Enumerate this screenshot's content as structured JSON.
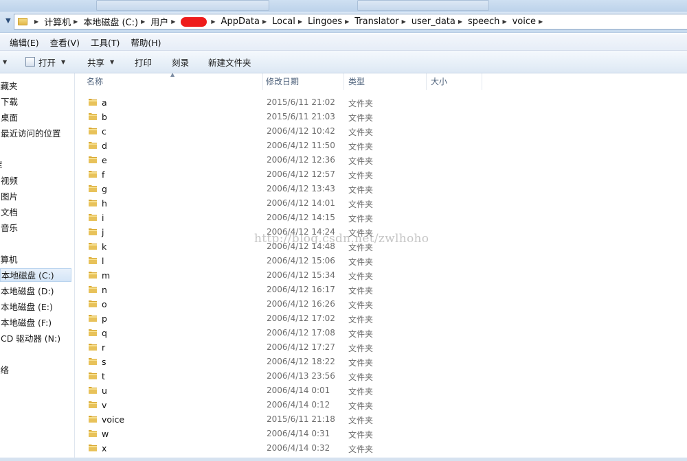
{
  "address": {
    "crumbs": [
      "计算机",
      "本地磁盘 (C:)",
      "用户",
      "",
      "AppData",
      "Local",
      "Lingoes",
      "Translator",
      "user_data",
      "speech",
      "voice"
    ]
  },
  "menu": [
    "编辑(E)",
    "查看(V)",
    "工具(T)",
    "帮助(H)"
  ],
  "toolbar": {
    "open": "打开",
    "share": "共享",
    "print": "打印",
    "burn": "刻录",
    "new_folder": "新建文件夹"
  },
  "nav": {
    "favorites": "收藏夹",
    "downloads": "下载",
    "desktop": "桌面",
    "recent": "最近访问的位置",
    "libraries": "库",
    "videos": "视频",
    "pictures": "图片",
    "documents": "文档",
    "music": "音乐",
    "computer": "计算机",
    "drive_c": "本地磁盘 (C:)",
    "drive_d": "本地磁盘 (D:)",
    "drive_e": "本地磁盘 (E:)",
    "drive_f": "本地磁盘 (F:)",
    "drive_n": "CD 驱动器 (N:)",
    "network": "网络"
  },
  "columns": {
    "name": "名称",
    "modified": "修改日期",
    "type": "类型",
    "size": "大小"
  },
  "files": [
    {
      "name": "a",
      "date": "2015/6/11 21:02",
      "type": "文件夹"
    },
    {
      "name": "b",
      "date": "2015/6/11 21:03",
      "type": "文件夹"
    },
    {
      "name": "c",
      "date": "2006/4/12 10:42",
      "type": "文件夹"
    },
    {
      "name": "d",
      "date": "2006/4/12 11:50",
      "type": "文件夹"
    },
    {
      "name": "e",
      "date": "2006/4/12 12:36",
      "type": "文件夹"
    },
    {
      "name": "f",
      "date": "2006/4/12 12:57",
      "type": "文件夹"
    },
    {
      "name": "g",
      "date": "2006/4/12 13:43",
      "type": "文件夹"
    },
    {
      "name": "h",
      "date": "2006/4/12 14:01",
      "type": "文件夹"
    },
    {
      "name": "i",
      "date": "2006/4/12 14:15",
      "type": "文件夹"
    },
    {
      "name": "j",
      "date": "2006/4/12 14:24",
      "type": "文件夹"
    },
    {
      "name": "k",
      "date": "2006/4/12 14:48",
      "type": "文件夹"
    },
    {
      "name": "l",
      "date": "2006/4/12 15:06",
      "type": "文件夹"
    },
    {
      "name": "m",
      "date": "2006/4/12 15:34",
      "type": "文件夹"
    },
    {
      "name": "n",
      "date": "2006/4/12 16:17",
      "type": "文件夹"
    },
    {
      "name": "o",
      "date": "2006/4/12 16:26",
      "type": "文件夹"
    },
    {
      "name": "p",
      "date": "2006/4/12 17:02",
      "type": "文件夹"
    },
    {
      "name": "q",
      "date": "2006/4/12 17:08",
      "type": "文件夹"
    },
    {
      "name": "r",
      "date": "2006/4/12 17:27",
      "type": "文件夹"
    },
    {
      "name": "s",
      "date": "2006/4/12 18:22",
      "type": "文件夹"
    },
    {
      "name": "t",
      "date": "2006/4/13 23:56",
      "type": "文件夹"
    },
    {
      "name": "u",
      "date": "2006/4/14 0:01",
      "type": "文件夹"
    },
    {
      "name": "v",
      "date": "2006/4/14 0:12",
      "type": "文件夹"
    },
    {
      "name": "voice",
      "date": "2015/6/11 21:18",
      "type": "文件夹"
    },
    {
      "name": "w",
      "date": "2006/4/14 0:31",
      "type": "文件夹"
    },
    {
      "name": "x",
      "date": "2006/4/14 0:32",
      "type": "文件夹"
    }
  ],
  "watermark": "http://blog.csdn.net/zwlhoho",
  "colors": {
    "redaction": "#ee1c1c",
    "folder": "#e8c25a",
    "selected_bg": "#d4e5f7"
  }
}
